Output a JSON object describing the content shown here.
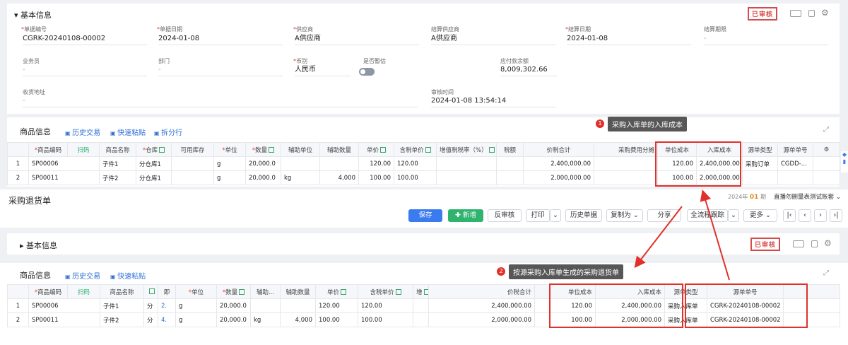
{
  "top": {
    "basic_title": "基本信息",
    "stamp": "已审核",
    "fields": [
      {
        "label": "单据编号",
        "required": true,
        "value": "CGRK-20240108-00002"
      },
      {
        "label": "单据日期",
        "required": true,
        "value": "2024-01-08"
      },
      {
        "label": "供应商",
        "required": true,
        "value": "A供应商"
      },
      {
        "label": "结算供应商",
        "required": false,
        "value": "A供应商"
      },
      {
        "label": "结算日期",
        "required": true,
        "value": "2024-01-08"
      },
      {
        "label": "结算期限",
        "required": false,
        "value": "-"
      },
      {
        "label": "业务员",
        "required": false,
        "value": "-"
      },
      {
        "label": "部门",
        "required": false,
        "value": "-"
      },
      {
        "label": "币别",
        "required": true,
        "value": "人民币"
      },
      {
        "label": "是否暂估",
        "required": false,
        "value": ""
      },
      {
        "label": "应付款余额",
        "required": false,
        "value": "8,009,302.66"
      },
      {
        "label": "收货地址",
        "required": false,
        "value": "-"
      },
      {
        "label": "审核时间",
        "required": false,
        "value": "2024-01-08 13:54:14"
      }
    ],
    "goods_title": "商品信息",
    "links": [
      "历史交易",
      "快速粘贴",
      "拆分行"
    ],
    "annotation": "采购入库单的入库成本",
    "annotation_num": "1",
    "columns": [
      "",
      "商品编码",
      "扫码",
      "商品名称",
      "仓库",
      "可用库存",
      "单位",
      "数量",
      "辅助单位",
      "辅助数量",
      "单价",
      "含税单价",
      "增值税税率（%）",
      "税额",
      "价税合计",
      "采购费用分摊",
      "单位成本",
      "入库成本",
      "源单类型",
      "源单单号"
    ],
    "rows": [
      [
        "1",
        "SP00006",
        "子件1",
        "分仓库1",
        "",
        "g",
        "20,000.0",
        "",
        "",
        "120.00",
        "120.00",
        "",
        "",
        "2,400,000.00",
        "",
        "120.00",
        "2,400,000.00",
        "采购订单",
        "CGDD-..."
      ],
      [
        "2",
        "SP00011",
        "子件2",
        "分仓库1",
        "",
        "g",
        "20,000.0",
        "kg",
        "4,000",
        "100.00",
        "100.00",
        "",
        "",
        "2,000,000.00",
        "",
        "100.00",
        "2,000,000.00",
        "",
        ""
      ]
    ],
    "period_label": "2024年",
    "period_num": "01",
    "period_unit": "期",
    "account_set": "直播勿删量表测试账套"
  },
  "bottom": {
    "title": "采购退货单",
    "buttons": {
      "save": "保存",
      "new": "新增",
      "unaudit": "反审核",
      "print": "打印",
      "history": "历史单据",
      "copy": "复制为",
      "share": "分享",
      "trace": "全流程跟踪",
      "more": "更多"
    },
    "basic_title": "基本信息",
    "stamp": "已审核",
    "goods_title": "商品信息",
    "links": [
      "历史交易",
      "快速粘贴"
    ],
    "annotation": "按源采购入库单生成的采购退货单",
    "annotation_num": "2",
    "columns": [
      "",
      "商品编码",
      "扫码",
      "商品名称",
      "仓",
      "即",
      "单位",
      "数量",
      "辅助...",
      "辅助数量",
      "单价",
      "含税单价",
      "增",
      "价税合计",
      "单位成本",
      "入库成本",
      "源单类型",
      "源单单号"
    ],
    "rows": [
      [
        "1",
        "SP00006",
        "子件1",
        "分",
        "2.",
        "g",
        "20,000.0",
        "",
        "",
        "120.00",
        "120.00",
        "",
        "2,400,000.00",
        "120.00",
        "2,400,000.00",
        "采购入库单",
        "CGRK-20240108-00002"
      ],
      [
        "2",
        "SP00011",
        "子件2",
        "分",
        "4.",
        "g",
        "20,000.0",
        "kg",
        "4,000",
        "100.00",
        "100.00",
        "",
        "2,000,000.00",
        "100.00",
        "2,000,000.00",
        "采购入库单",
        "CGRK-20240108-00002"
      ]
    ]
  },
  "colors": {
    "accent": "#3a7bef",
    "green": "#2fb36f",
    "red": "#e0312b"
  }
}
